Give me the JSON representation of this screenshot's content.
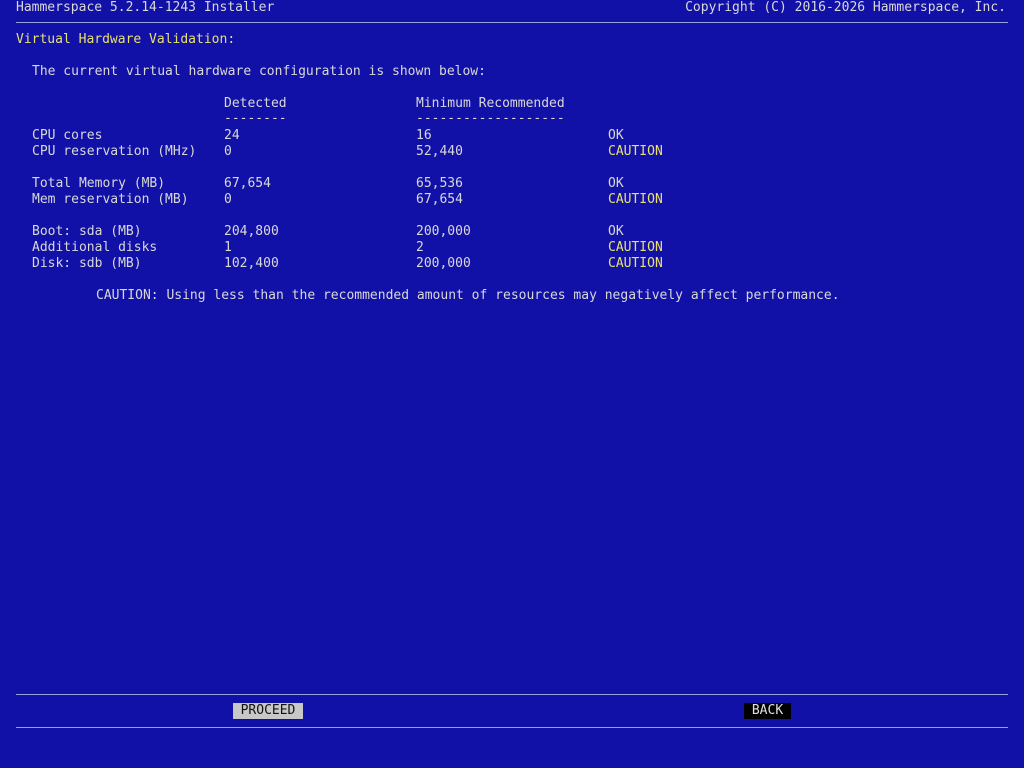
{
  "header": {
    "title": "Hammerspace 5.2.14-1243 Installer",
    "copyright": "Copyright (C) 2016-2026 Hammerspace, Inc."
  },
  "section_title": "Virtual Hardware Validation:",
  "intro": "The current virtual hardware configuration is shown below:",
  "columns": {
    "detected": "Detected",
    "detected_underline": "--------",
    "minimum": "Minimum Recommended",
    "minimum_underline": "-------------------"
  },
  "rows": [
    {
      "label": "CPU cores",
      "detected": "24",
      "minimum": "16",
      "status": "OK"
    },
    {
      "label": "CPU reservation (MHz)",
      "detected": "0",
      "minimum": "52,440",
      "status": "CAUTION"
    },
    {
      "label": "Total Memory (MB)",
      "detected": "67,654",
      "minimum": "65,536",
      "status": "OK"
    },
    {
      "label": "Mem reservation (MB)",
      "detected": "0",
      "minimum": "67,654",
      "status": "CAUTION"
    },
    {
      "label": "Boot: sda (MB)",
      "detected": "204,800",
      "minimum": "200,000",
      "status": "OK"
    },
    {
      "label": "Additional disks",
      "detected": "1",
      "minimum": "2",
      "status": "CAUTION"
    },
    {
      "label": "Disk: sdb (MB)",
      "detected": "102,400",
      "minimum": "200,000",
      "status": "CAUTION"
    }
  ],
  "caution_note": "CAUTION: Using less than the recommended amount of resources may negatively affect performance.",
  "buttons": {
    "proceed": "PROCEED",
    "back": "BACK"
  },
  "colors": {
    "background": "#1111a8",
    "text": "#d8d8d8",
    "caution": "#e8e070",
    "section_title": "#e8e070"
  }
}
